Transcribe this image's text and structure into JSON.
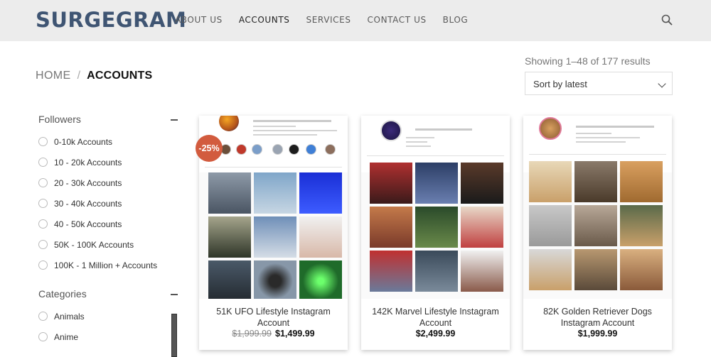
{
  "header": {
    "logo": "SURGEGRAM",
    "nav": [
      "ABOUT US",
      "ACCOUNTS",
      "SERVICES",
      "CONTACT US",
      "BLOG"
    ],
    "active_nav": "ACCOUNTS",
    "search_icon": "search-icon"
  },
  "breadcrumb": {
    "home": "HOME",
    "separator": "/",
    "current": "ACCOUNTS"
  },
  "shop": {
    "results_text": "Showing 1–48 of 177 results",
    "sort_selected": "Sort by latest"
  },
  "sidebar": {
    "followers": {
      "heading": "Followers",
      "options": [
        "0-10k Accounts",
        "10 - 20k Accounts",
        "20 - 30k Accounts",
        "30 - 40k Accounts",
        "40 - 50k Accounts",
        "50K - 100K Accounts",
        "100K - 1 Million + Accounts"
      ]
    },
    "categories": {
      "heading": "Categories",
      "options": [
        "Animals",
        "Anime"
      ]
    }
  },
  "products": [
    {
      "title": "51K UFO Lifestyle Instagram Account",
      "old_price": "$1,999.99",
      "price": "$1,499.99",
      "badge": "-25%"
    },
    {
      "title": "142K Marvel Lifestyle Instagram Account",
      "price": "$2,499.99"
    },
    {
      "title": "82K Golden Retriever Dogs Instagram Account",
      "price": "$1,999.99"
    }
  ],
  "colors": {
    "logo": "#3f5573",
    "header_bg": "#ececec",
    "badge": "#d25b3e"
  }
}
